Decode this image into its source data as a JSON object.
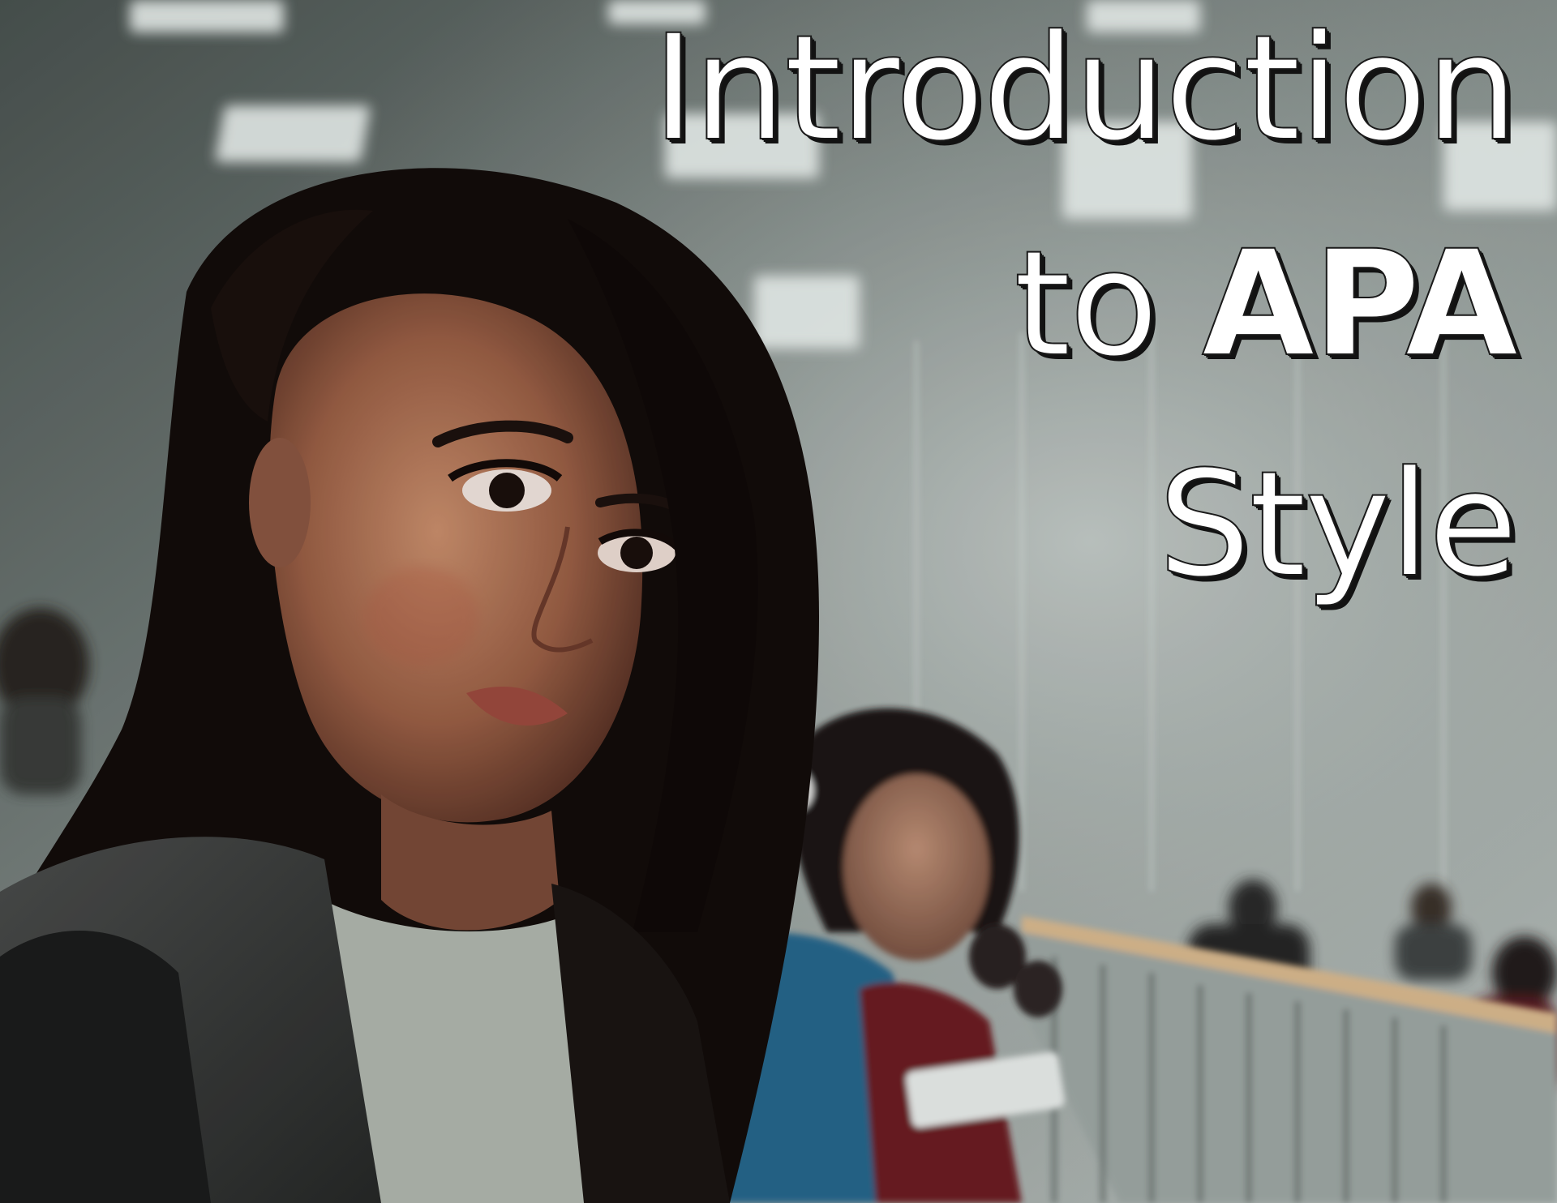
{
  "title": {
    "line1": "Introduction",
    "line2_light": "to",
    "line2_bold": "APA",
    "line3": "Style"
  },
  "colors": {
    "title_fill": "#ffffff",
    "title_outline": "#121212",
    "background_tone": "#5b6361"
  }
}
